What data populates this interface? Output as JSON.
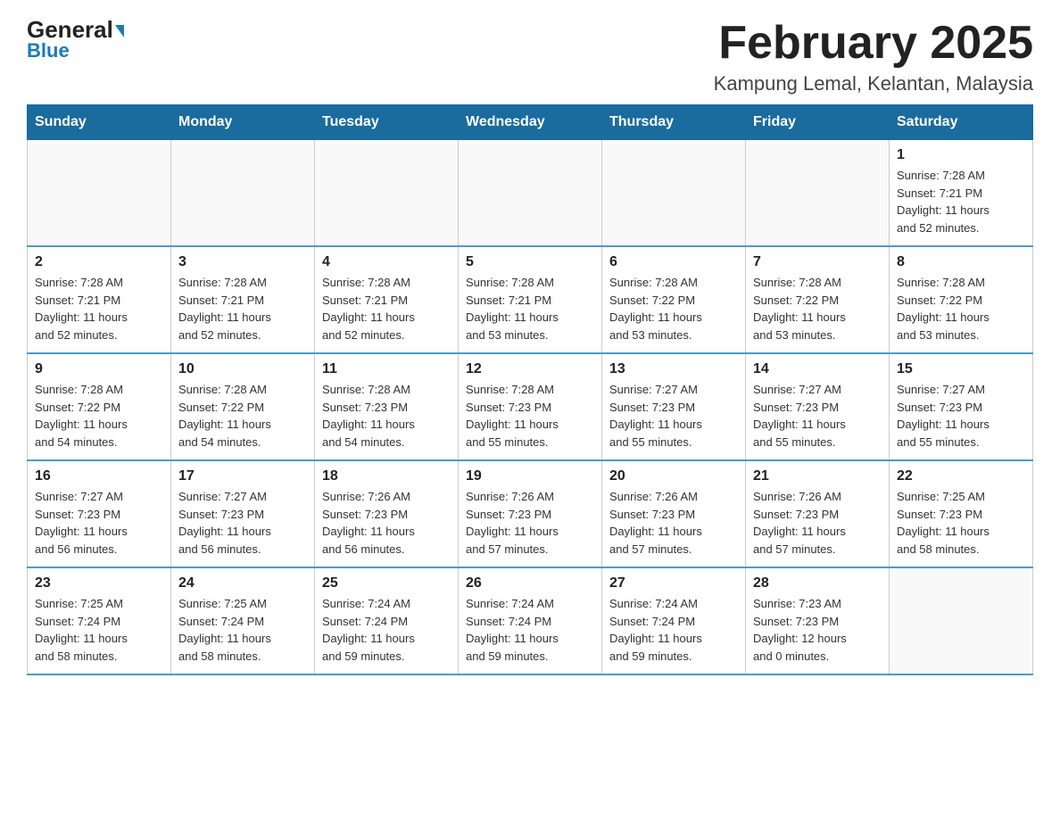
{
  "header": {
    "logo_line1": "General",
    "logo_line2": "Blue",
    "month_title": "February 2025",
    "location": "Kampung Lemal, Kelantan, Malaysia"
  },
  "weekdays": [
    "Sunday",
    "Monday",
    "Tuesday",
    "Wednesday",
    "Thursday",
    "Friday",
    "Saturday"
  ],
  "weeks": [
    [
      {
        "day": "",
        "info": ""
      },
      {
        "day": "",
        "info": ""
      },
      {
        "day": "",
        "info": ""
      },
      {
        "day": "",
        "info": ""
      },
      {
        "day": "",
        "info": ""
      },
      {
        "day": "",
        "info": ""
      },
      {
        "day": "1",
        "info": "Sunrise: 7:28 AM\nSunset: 7:21 PM\nDaylight: 11 hours\nand 52 minutes."
      }
    ],
    [
      {
        "day": "2",
        "info": "Sunrise: 7:28 AM\nSunset: 7:21 PM\nDaylight: 11 hours\nand 52 minutes."
      },
      {
        "day": "3",
        "info": "Sunrise: 7:28 AM\nSunset: 7:21 PM\nDaylight: 11 hours\nand 52 minutes."
      },
      {
        "day": "4",
        "info": "Sunrise: 7:28 AM\nSunset: 7:21 PM\nDaylight: 11 hours\nand 52 minutes."
      },
      {
        "day": "5",
        "info": "Sunrise: 7:28 AM\nSunset: 7:21 PM\nDaylight: 11 hours\nand 53 minutes."
      },
      {
        "day": "6",
        "info": "Sunrise: 7:28 AM\nSunset: 7:22 PM\nDaylight: 11 hours\nand 53 minutes."
      },
      {
        "day": "7",
        "info": "Sunrise: 7:28 AM\nSunset: 7:22 PM\nDaylight: 11 hours\nand 53 minutes."
      },
      {
        "day": "8",
        "info": "Sunrise: 7:28 AM\nSunset: 7:22 PM\nDaylight: 11 hours\nand 53 minutes."
      }
    ],
    [
      {
        "day": "9",
        "info": "Sunrise: 7:28 AM\nSunset: 7:22 PM\nDaylight: 11 hours\nand 54 minutes."
      },
      {
        "day": "10",
        "info": "Sunrise: 7:28 AM\nSunset: 7:22 PM\nDaylight: 11 hours\nand 54 minutes."
      },
      {
        "day": "11",
        "info": "Sunrise: 7:28 AM\nSunset: 7:23 PM\nDaylight: 11 hours\nand 54 minutes."
      },
      {
        "day": "12",
        "info": "Sunrise: 7:28 AM\nSunset: 7:23 PM\nDaylight: 11 hours\nand 55 minutes."
      },
      {
        "day": "13",
        "info": "Sunrise: 7:27 AM\nSunset: 7:23 PM\nDaylight: 11 hours\nand 55 minutes."
      },
      {
        "day": "14",
        "info": "Sunrise: 7:27 AM\nSunset: 7:23 PM\nDaylight: 11 hours\nand 55 minutes."
      },
      {
        "day": "15",
        "info": "Sunrise: 7:27 AM\nSunset: 7:23 PM\nDaylight: 11 hours\nand 55 minutes."
      }
    ],
    [
      {
        "day": "16",
        "info": "Sunrise: 7:27 AM\nSunset: 7:23 PM\nDaylight: 11 hours\nand 56 minutes."
      },
      {
        "day": "17",
        "info": "Sunrise: 7:27 AM\nSunset: 7:23 PM\nDaylight: 11 hours\nand 56 minutes."
      },
      {
        "day": "18",
        "info": "Sunrise: 7:26 AM\nSunset: 7:23 PM\nDaylight: 11 hours\nand 56 minutes."
      },
      {
        "day": "19",
        "info": "Sunrise: 7:26 AM\nSunset: 7:23 PM\nDaylight: 11 hours\nand 57 minutes."
      },
      {
        "day": "20",
        "info": "Sunrise: 7:26 AM\nSunset: 7:23 PM\nDaylight: 11 hours\nand 57 minutes."
      },
      {
        "day": "21",
        "info": "Sunrise: 7:26 AM\nSunset: 7:23 PM\nDaylight: 11 hours\nand 57 minutes."
      },
      {
        "day": "22",
        "info": "Sunrise: 7:25 AM\nSunset: 7:23 PM\nDaylight: 11 hours\nand 58 minutes."
      }
    ],
    [
      {
        "day": "23",
        "info": "Sunrise: 7:25 AM\nSunset: 7:24 PM\nDaylight: 11 hours\nand 58 minutes."
      },
      {
        "day": "24",
        "info": "Sunrise: 7:25 AM\nSunset: 7:24 PM\nDaylight: 11 hours\nand 58 minutes."
      },
      {
        "day": "25",
        "info": "Sunrise: 7:24 AM\nSunset: 7:24 PM\nDaylight: 11 hours\nand 59 minutes."
      },
      {
        "day": "26",
        "info": "Sunrise: 7:24 AM\nSunset: 7:24 PM\nDaylight: 11 hours\nand 59 minutes."
      },
      {
        "day": "27",
        "info": "Sunrise: 7:24 AM\nSunset: 7:24 PM\nDaylight: 11 hours\nand 59 minutes."
      },
      {
        "day": "28",
        "info": "Sunrise: 7:23 AM\nSunset: 7:23 PM\nDaylight: 12 hours\nand 0 minutes."
      },
      {
        "day": "",
        "info": ""
      }
    ]
  ]
}
